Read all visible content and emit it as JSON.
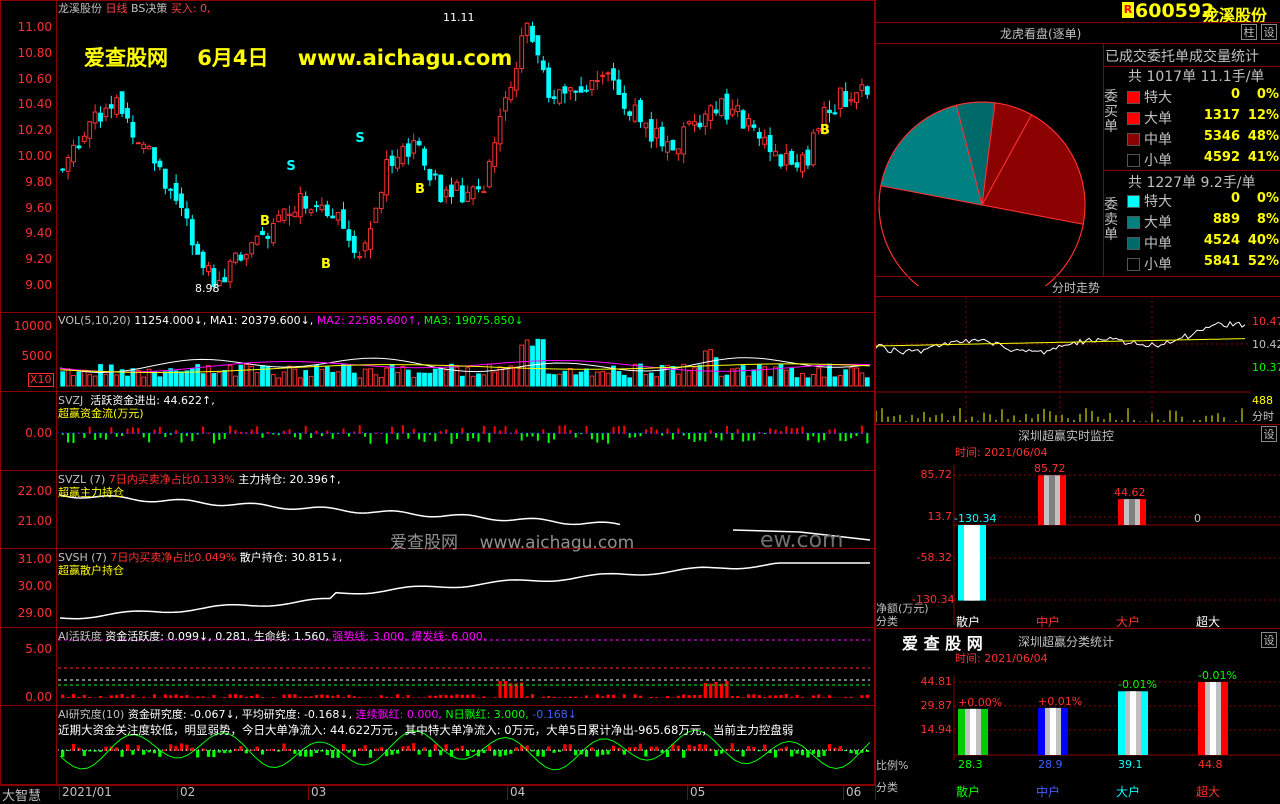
{
  "header": {
    "stock_name": "龙溪股份",
    "period": "日线",
    "indicator": "BS决策",
    "buy_label": "买入: 0,",
    "watermark_site": "爱查股网",
    "watermark_date": "6月4日",
    "watermark_url": "www.aichagu.com",
    "max_price": "11.11",
    "min_price": "8.98"
  },
  "price_axis": [
    "11.00",
    "10.80",
    "10.60",
    "10.40",
    "10.20",
    "10.00",
    "9.80",
    "9.60",
    "9.40",
    "9.20",
    "9.00"
  ],
  "vol": {
    "title": "VOL(5,10,20)",
    "v": "11254.000↓,",
    "ma1": "MA1: 20379.600↓,",
    "ma2": "MA2: 22585.600↑,",
    "ma3": "MA3: 19075.850↓",
    "axis": [
      "10000",
      "5000"
    ],
    "unit": "X10"
  },
  "svzj": {
    "title": "SVZJ",
    "line1": "活跃资金进出: 44.622↑,",
    "line2": "超赢资金流(万元)",
    "axis": "0.00"
  },
  "svzl": {
    "title": "SVZL (7)",
    "desc": "7日内买卖净占比0.133%",
    "extra": "主力持仓: 20.396↑,",
    "line2": "超赢主力持仓",
    "axis": [
      "22.00",
      "21.00"
    ]
  },
  "svsh": {
    "title": "SVSH (7)",
    "desc": "7日内买卖净占比0.049%",
    "extra": "散户持仓: 30.815↓,",
    "line2": "超赢散户持仓",
    "axis": [
      "31.00",
      "30.00",
      "29.00"
    ]
  },
  "ai_active": {
    "title": "AI活跃度",
    "l1": "资金活跃度: 0.099↓,",
    "l2": "0.281,",
    "l3": "生命线: 1.560,",
    "l4": "强势线: 3.000,",
    "l5": "爆发线: 6.000,",
    "axis": [
      "5.00",
      "0.00"
    ]
  },
  "ai_research": {
    "title": "AI研究度(10)",
    "l1": "资金研究度: -0.067↓,",
    "l2": "平均研究度: -0.168↓,",
    "l3": "连续飘红: 0.000,",
    "l4": "N日飘红: 3.000,",
    "l5": "-0.168↓",
    "comment": "近期大资金关注度较低，明显弱势，今日大单净流入: 44.622万元，其中特大单净流入: 0万元，大单5日累计净出-965.68万元，当前主力控盘弱"
  },
  "date_axis": [
    "2021/01",
    "02",
    "03",
    "04",
    "05",
    "06"
  ],
  "corner_label": "大智慧",
  "right": {
    "code": "600592",
    "name": "龙溪股份",
    "r_badge": "R",
    "btn_zhu": "柱",
    "btn_she": "设",
    "dragon_title": "龙虎看盘(逐单)",
    "stat_title": "已成交委托单成交量统计",
    "buy_label": "委买单",
    "sell_label": "委卖单",
    "buy_total": "共 1017单 11.1手/单",
    "sell_total": "共 1227单 9.2手/单",
    "buy_rows": [
      {
        "name": "特大",
        "count": "0",
        "pct": "0%",
        "color": "#ff0000"
      },
      {
        "name": "大单",
        "count": "1317",
        "pct": "12%",
        "color": "#ff0000"
      },
      {
        "name": "中单",
        "count": "5346",
        "pct": "48%",
        "color": "#8b0000"
      },
      {
        "name": "小单",
        "count": "4592",
        "pct": "41%",
        "color": "#000000"
      }
    ],
    "sell_rows": [
      {
        "name": "特大",
        "count": "0",
        "pct": "0%",
        "color": "#00ffff"
      },
      {
        "name": "大单",
        "count": "889",
        "pct": "8%",
        "color": "#008080"
      },
      {
        "name": "中单",
        "count": "4524",
        "pct": "40%",
        "color": "#006a6a"
      },
      {
        "name": "小单",
        "count": "5841",
        "pct": "52%",
        "color": "#000000"
      }
    ],
    "intraday_title": "分时走势",
    "intraday_axis": [
      "10.47",
      "10.42",
      "10.37"
    ],
    "intraday_vol_label": "488",
    "intraday_vol_unit": "分时",
    "monitor_title": "深圳超赢实时监控",
    "monitor_time": "时间: 2021/06/04",
    "monitor_axis": [
      "85.72",
      "13.7",
      "-58.32",
      "-130.34"
    ],
    "monitor_values": [
      "-130.34",
      "85.72",
      "44.62",
      "0"
    ],
    "monitor_unit": "净额(万元)",
    "cls_label": "分类",
    "categories": [
      "散户",
      "中户",
      "大户",
      "超大"
    ],
    "stat2_brand": "爱 查 股 网",
    "stat2_title": "深圳超赢分类统计",
    "stat2_time": "时间: 2021/06/04",
    "stat2_axis": [
      "44.81",
      "29.87",
      "14.94"
    ],
    "stat2_changes": [
      "+0.00%",
      "+0.01%",
      "-0.01%",
      "-0.01%"
    ],
    "stat2_values": [
      "28.3",
      "28.9",
      "39.1",
      "44.8"
    ],
    "ratio_label": "比例%"
  },
  "center_watermark": "爱查股网    www.aichagu.com",
  "center_watermark2": "ew.com"
}
